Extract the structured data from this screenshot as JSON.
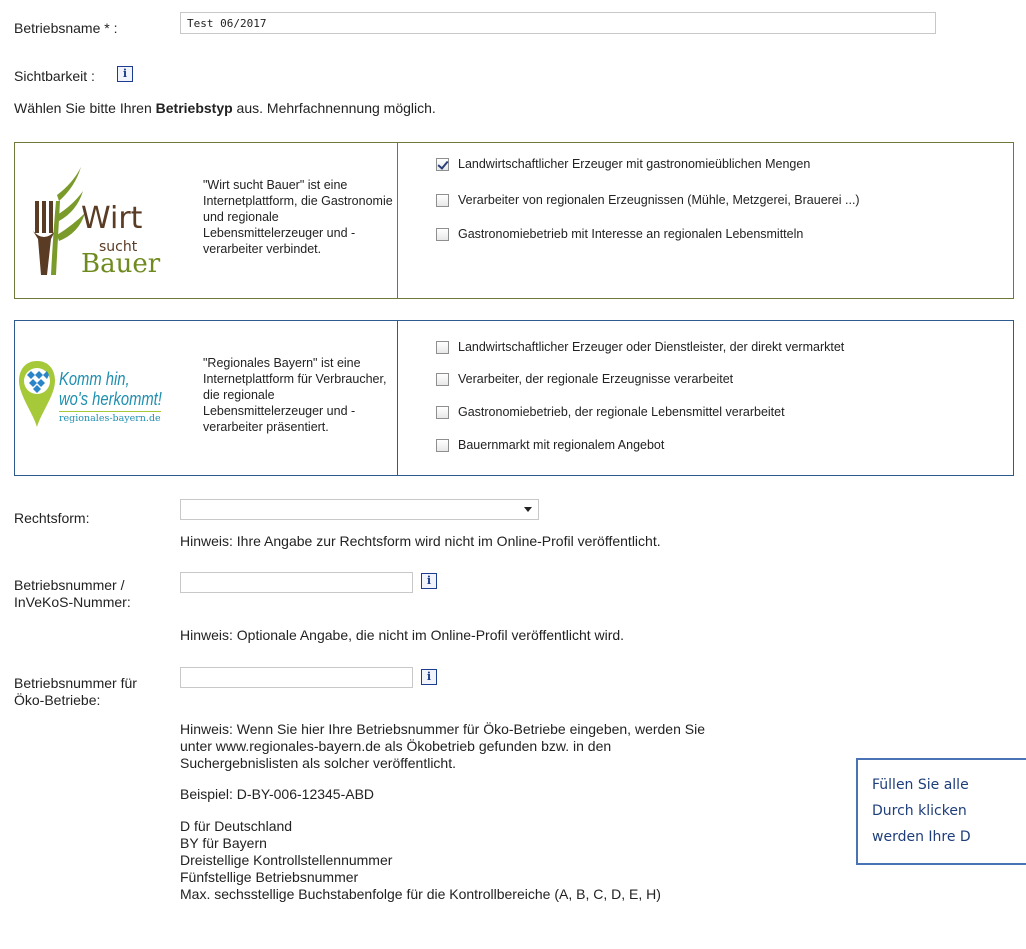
{
  "fields": {
    "betriebsname_label": "Betriebsname * :",
    "betriebsname_value": "Test 06/2017",
    "sichtbarkeit_label": "Sichtbarkeit :",
    "info_glyph": "i"
  },
  "intro": {
    "pre": "Wählen Sie bitte Ihren ",
    "bold": "Betriebstyp",
    "post": " aus. Mehrfachnennung möglich."
  },
  "wirt_panel": {
    "logo": {
      "line1": "Wirt",
      "line2": "sucht",
      "line3": "Bauer"
    },
    "description": "\"Wirt sucht Bauer\" ist eine Internetplattform, die Gastronomie und regionale Lebensmittelerzeuger und -verarbeiter verbindet.",
    "options": [
      {
        "label": "Landwirtschaftlicher Erzeuger mit gastronomieüblichen Mengen",
        "checked": true
      },
      {
        "label": "Verarbeiter von regionalen Erzeugnissen (Mühle, Metzgerei, Brauerei ...)",
        "checked": false
      },
      {
        "label": "Gastronomiebetrieb mit Interesse an regionalen Lebensmitteln",
        "checked": false
      }
    ]
  },
  "regional_panel": {
    "logo": {
      "line1": "Komm hin,",
      "line2": "wo's herkommt!",
      "line3": "regionales-bayern.de"
    },
    "description": "\"Regionales Bayern\" ist eine Internetplattform für Verbraucher, die regionale Lebensmittelerzeuger und -verarbeiter präsentiert.",
    "options": [
      {
        "label": "Landwirtschaftlicher Erzeuger oder Dienstleister, der direkt vermarktet",
        "checked": false
      },
      {
        "label": "Verarbeiter, der regionale Erzeugnisse verarbeitet",
        "checked": false
      },
      {
        "label": "Gastronomiebetrieb, der regionale Lebensmittel verarbeitet",
        "checked": false
      },
      {
        "label": "Bauernmarkt mit regionalem Angebot",
        "checked": false
      }
    ]
  },
  "rechtsform": {
    "label": "Rechtsform:",
    "selected": "",
    "hint": "Hinweis: Ihre Angabe zur Rechtsform wird nicht im Online-Profil veröffentlicht."
  },
  "betriebsnummer": {
    "label_line1": "Betriebsnummer /",
    "label_line2": "InVeKoS-Nummer:",
    "value": "",
    "hint": "Hinweis: Optionale Angabe, die nicht im Online-Profil veröffentlicht wird."
  },
  "oeko": {
    "label_line1": "Betriebsnummer für",
    "label_line2": "Öko-Betriebe:",
    "value": "",
    "hint_line1": "Hinweis: Wenn Sie hier Ihre Betriebsnummer für Öko-Betriebe eingeben, werden Sie",
    "hint_line2": "unter www.regionales-bayern.de als Ökobetrieb gefunden bzw. in den",
    "hint_line3": "Suchergebnislisten als solcher veröffentlicht.",
    "example": "Beispiel: D-BY-006-12345-ABD",
    "legend": [
      "D für Deutschland",
      "BY für Bayern",
      "Dreistellige Kontrollstellennummer",
      "Fünfstellige Betriebsnummer",
      "Max. sechsstellige Buchstabenfolge für die Kontrollbereiche (A, B, C, D, E, H)"
    ]
  },
  "callout": {
    "line1": "Füllen Sie alle",
    "line2": "Durch klicken",
    "line3": "werden Ihre D"
  },
  "colors": {
    "wirt_border": "#6e7a3a",
    "wirt_logo": "#5a3b24",
    "wirt_leaf": "#7a9a2a",
    "regional_border": "#2e5a8e",
    "regional_logo": "#1f8fb0",
    "regional_pin": "#a6c93a",
    "callout_border": "#4a73b5"
  }
}
